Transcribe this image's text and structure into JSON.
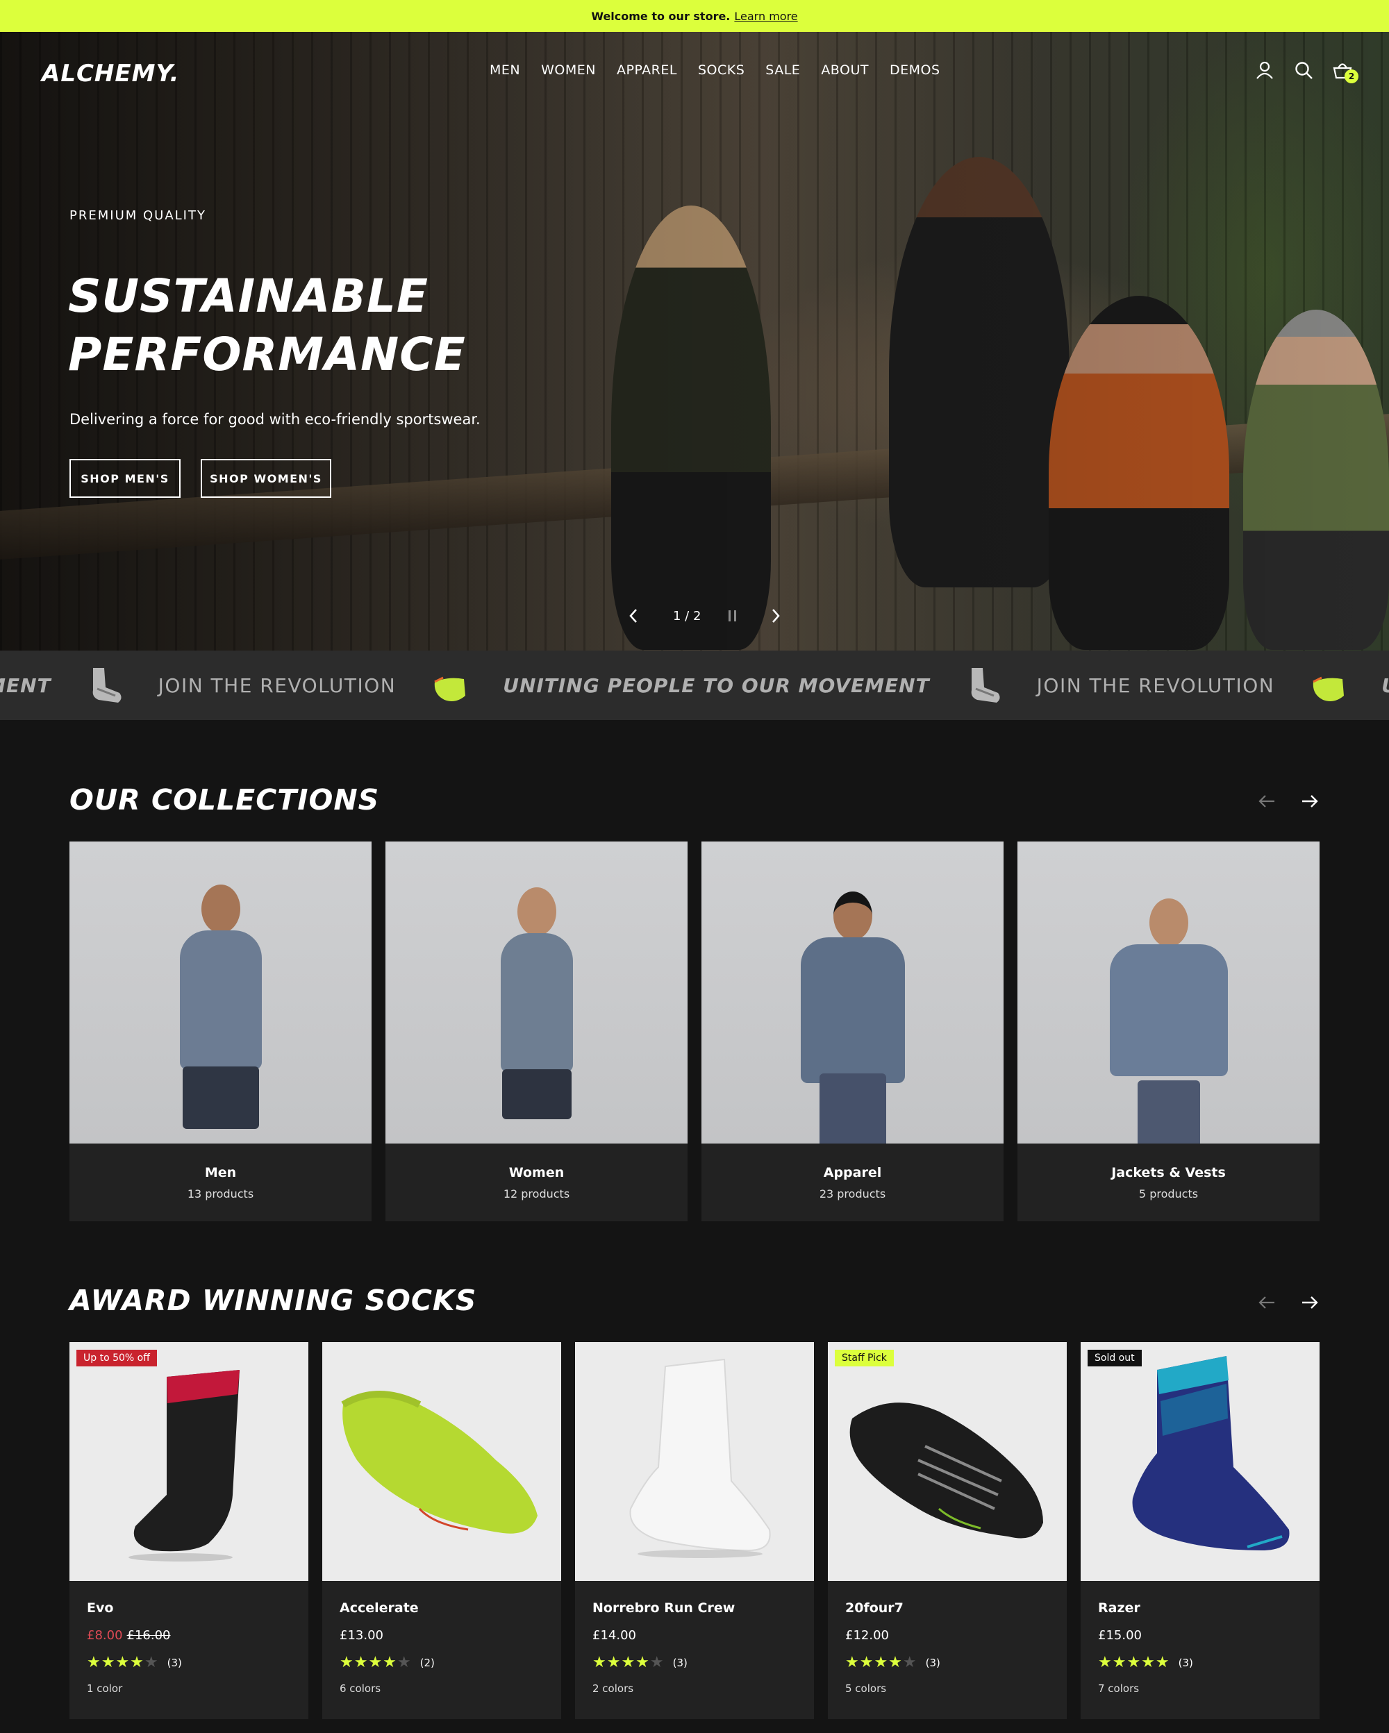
{
  "announcement": {
    "text": "Welcome to our store.",
    "link": "Learn more"
  },
  "header": {
    "logo": "ALCHEMY.",
    "menu": [
      "MEN",
      "WOMEN",
      "APPAREL",
      "SOCKS",
      "SALE",
      "ABOUT",
      "DEMOS"
    ],
    "cart_count": "2",
    "icons": [
      "account-icon",
      "search-icon",
      "cart-icon"
    ]
  },
  "hero": {
    "eyebrow": "PREMIUM QUALITY",
    "title": "SUSTAINABLE PERFORMANCE",
    "subtitle": "Delivering a force for good with eco-friendly sportswear.",
    "buttons": [
      "SHOP MEN'S",
      "SHOP WOMEN'S"
    ],
    "slide_indicator": "1 / 2"
  },
  "marquee": {
    "items": [
      "EMENT",
      "JOIN THE REVOLUTION",
      "UNITING PEOPLE TO OUR MOVEMENT",
      "JOIN THE REVOLUTION",
      "UNITING PEOPLE TO OUR M"
    ]
  },
  "collections": {
    "title": "OUR COLLECTIONS",
    "items": [
      {
        "name": "Men",
        "count": "13 products"
      },
      {
        "name": "Women",
        "count": "12 products"
      },
      {
        "name": "Apparel",
        "count": "23 products"
      },
      {
        "name": "Jackets & Vests",
        "count": "5 products"
      }
    ]
  },
  "socks": {
    "title": "AWARD WINNING SOCKS",
    "items": [
      {
        "badge": "Up to 50% off",
        "name": "Evo",
        "price": "£8.00",
        "old_price": "£16.00",
        "rating": 3.5,
        "stars": "★★★★",
        "stars_off": "★",
        "reviews": "(3)",
        "colors": "1 color"
      },
      {
        "badge": "",
        "name": "Accelerate",
        "price": "£13.00",
        "old_price": "",
        "rating": 3.5,
        "stars": "★★★★",
        "stars_off": "★",
        "reviews": "(2)",
        "colors": "6 colors"
      },
      {
        "badge": "",
        "name": "Norrebro Run Crew",
        "price": "£14.00",
        "old_price": "",
        "rating": 4,
        "stars": "★★★★",
        "stars_off": "★",
        "reviews": "(3)",
        "colors": "2 colors"
      },
      {
        "badge": "Staff Pick",
        "name": "20four7",
        "price": "£12.00",
        "old_price": "",
        "rating": 3.5,
        "stars": "★★★★",
        "stars_off": "★",
        "reviews": "(3)",
        "colors": "5 colors"
      },
      {
        "badge": "Sold out",
        "name": "Razer",
        "price": "£15.00",
        "old_price": "",
        "rating": 4.5,
        "stars": "★★★★★",
        "stars_off": "",
        "reviews": "(3)",
        "colors": "7 colors"
      }
    ]
  },
  "colors": {
    "accent": "#dcff3c",
    "sale": "#c9232e",
    "background": "#141414"
  }
}
